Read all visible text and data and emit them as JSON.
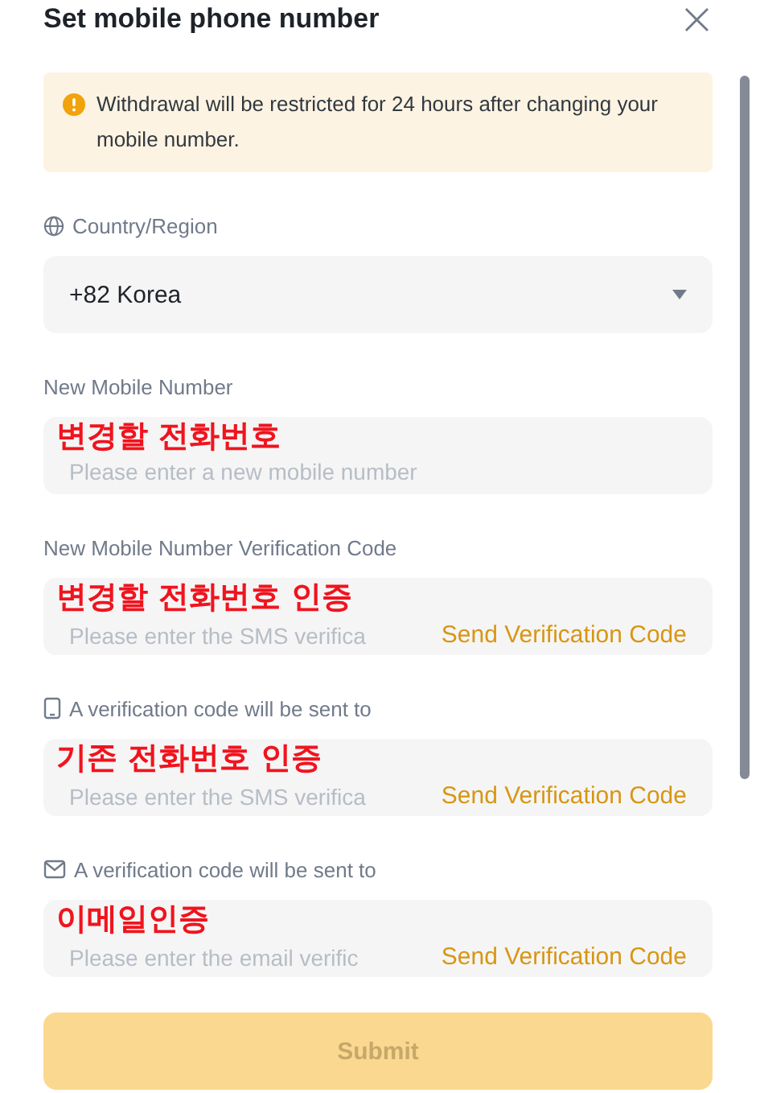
{
  "dialog": {
    "title": "Set mobile phone number",
    "close": "×"
  },
  "notice": {
    "text": "Withdrawal will be restricted for 24 hours after changing your mobile number."
  },
  "fields": [
    {
      "kind": "select",
      "label": "Country/Region",
      "value": "+82 Korea"
    },
    {
      "kind": "input",
      "label": "New Mobile Number",
      "placeholder": "Please enter a new mobile number",
      "annotation": "변경할 전화번호"
    },
    {
      "kind": "code",
      "label": "New Mobile Number Verification Code",
      "placeholder": "Please enter the SMS verifica",
      "action": "Send Verification Code",
      "annotation": "변경할 전화번호 인증"
    },
    {
      "kind": "code",
      "label": "A verification code will be sent to",
      "placeholder": "Please enter the SMS verifica",
      "action": "Send Verification Code",
      "annotation": "기존 전화번호 인증"
    },
    {
      "kind": "code",
      "label": "A verification code will be sent to",
      "placeholder": "Please enter the email verific",
      "action": "Send Verification Code",
      "annotation": "이메일인증"
    }
  ],
  "submit": {
    "label": "Submit",
    "disabled": true
  }
}
